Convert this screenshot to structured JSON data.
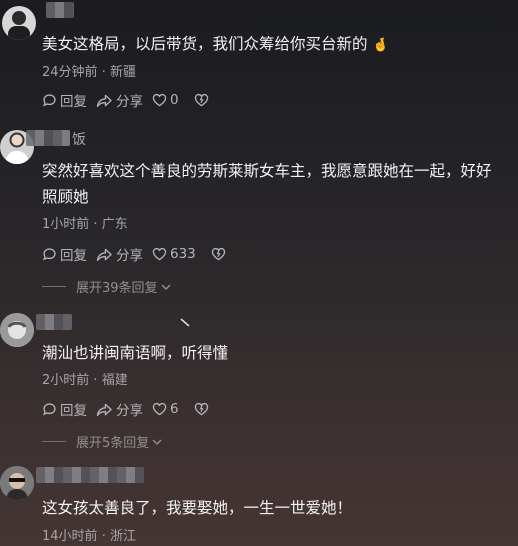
{
  "comments": [
    {
      "username_visible": "",
      "text": "美女这格局，以后带货，我们众筹给你买台新的",
      "emoji": "🤞",
      "time": "24分钟前",
      "location": "新疆",
      "reply_label": "回复",
      "share_label": "分享",
      "likes": "0"
    },
    {
      "username_visible": "饭",
      "text": "突然好喜欢这个善良的劳斯莱斯女车主，我愿意跟她在一起，好好照顾她",
      "time": "1小时前",
      "location": "广东",
      "reply_label": "回复",
      "share_label": "分享",
      "likes": "633",
      "expand_label": "展开39条回复"
    },
    {
      "username_visible": "",
      "text": "潮汕也讲闽南语啊，听得懂",
      "time": "2小时前",
      "location": "福建",
      "reply_label": "回复",
      "share_label": "分享",
      "likes": "6",
      "expand_label": "展开5条回复"
    },
    {
      "username_visible": "",
      "text": "这女孩太善良了，我要娶她，一生一世爱她！",
      "time": "14小时前",
      "location": "浙江"
    }
  ],
  "separator": "·",
  "icons": [
    "avatar",
    "reply-bubble-icon",
    "share-arrow-icon",
    "like-heart-icon",
    "dislike-heart-icon",
    "chevron-down-icon"
  ]
}
